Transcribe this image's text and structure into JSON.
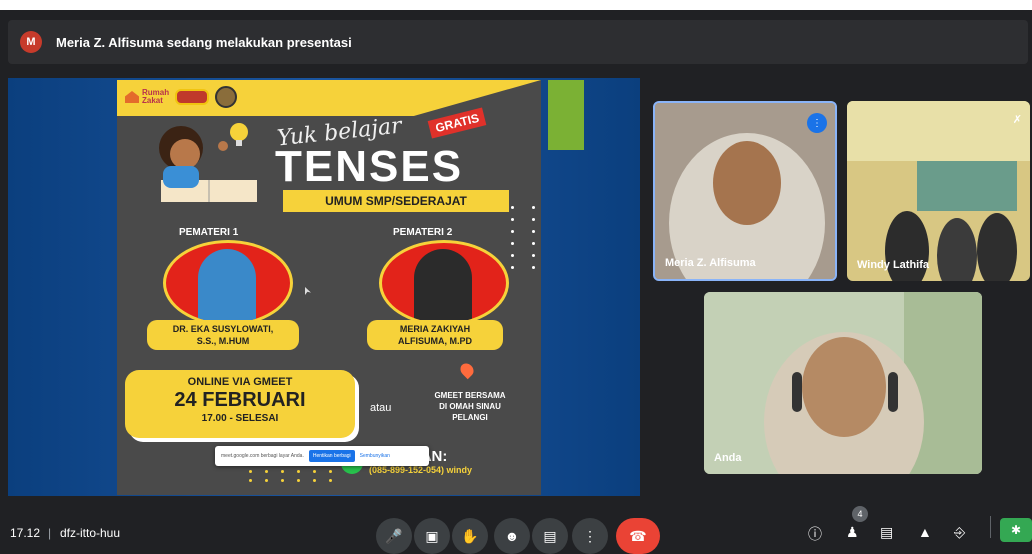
{
  "presenter_bar": {
    "text": "Meria Z. Alfisuma sedang melakukan presentasi",
    "avatar_initial": "M"
  },
  "poster": {
    "logo_text_1": "Rumah",
    "logo_text_2": "Zakat",
    "script_title": "Yuk belajar",
    "badge": "GRATIS",
    "title": "TENSES",
    "audience": "UMUM SMP/SEDERAJAT",
    "speaker1_label": "PEMATERI 1",
    "speaker1_name_1": "DR. EKA SUSYLOWATI,",
    "speaker1_name_2": "S.S., M.HUM",
    "speaker2_label": "PEMATERI 2",
    "speaker2_name_1": "MERIA ZAKIYAH",
    "speaker2_name_2": "ALFISUMA, M.PD",
    "online_label": "ONLINE VIA GMEET",
    "date": "24 FEBRUARI",
    "time": "17.00 - SELESAI",
    "or": "atau",
    "alt_1": "GMEET BERSAMA",
    "alt_2": "DI OMAH SINAU",
    "alt_3": "PELANGI",
    "registration": "AFTARAN:",
    "phone": "(085-899-152-054) windy"
  },
  "share_notice": {
    "text": "meet.google.com berbagi layar Anda.",
    "stop_label": "Hentikan berbagi",
    "hide_label": "Sembunyikan"
  },
  "participants": [
    {
      "name": "Meria Z. Alfisuma"
    },
    {
      "name": "Windy Lathifa"
    },
    {
      "name": "Anda"
    }
  ],
  "bottom_bar": {
    "time": "17.12",
    "separator": "|",
    "meeting_code": "dfz-itto-huu",
    "participant_count": "4"
  },
  "colors": {
    "accent_yellow": "#f6d23a",
    "stage_blue": "#1a55a0",
    "end_call_red": "#ea4335",
    "active_speaker_border": "#8ab4f8"
  },
  "icons": {
    "mic": "mic-icon",
    "camera": "camera-icon",
    "raise_hand": "raise-hand-icon",
    "captions": "captions-icon",
    "present": "present-icon",
    "more": "more-icon",
    "end_call": "end-call-icon",
    "info": "info-icon",
    "people": "people-icon",
    "chat": "chat-icon",
    "activities": "activities-icon",
    "lock": "lock-icon"
  }
}
